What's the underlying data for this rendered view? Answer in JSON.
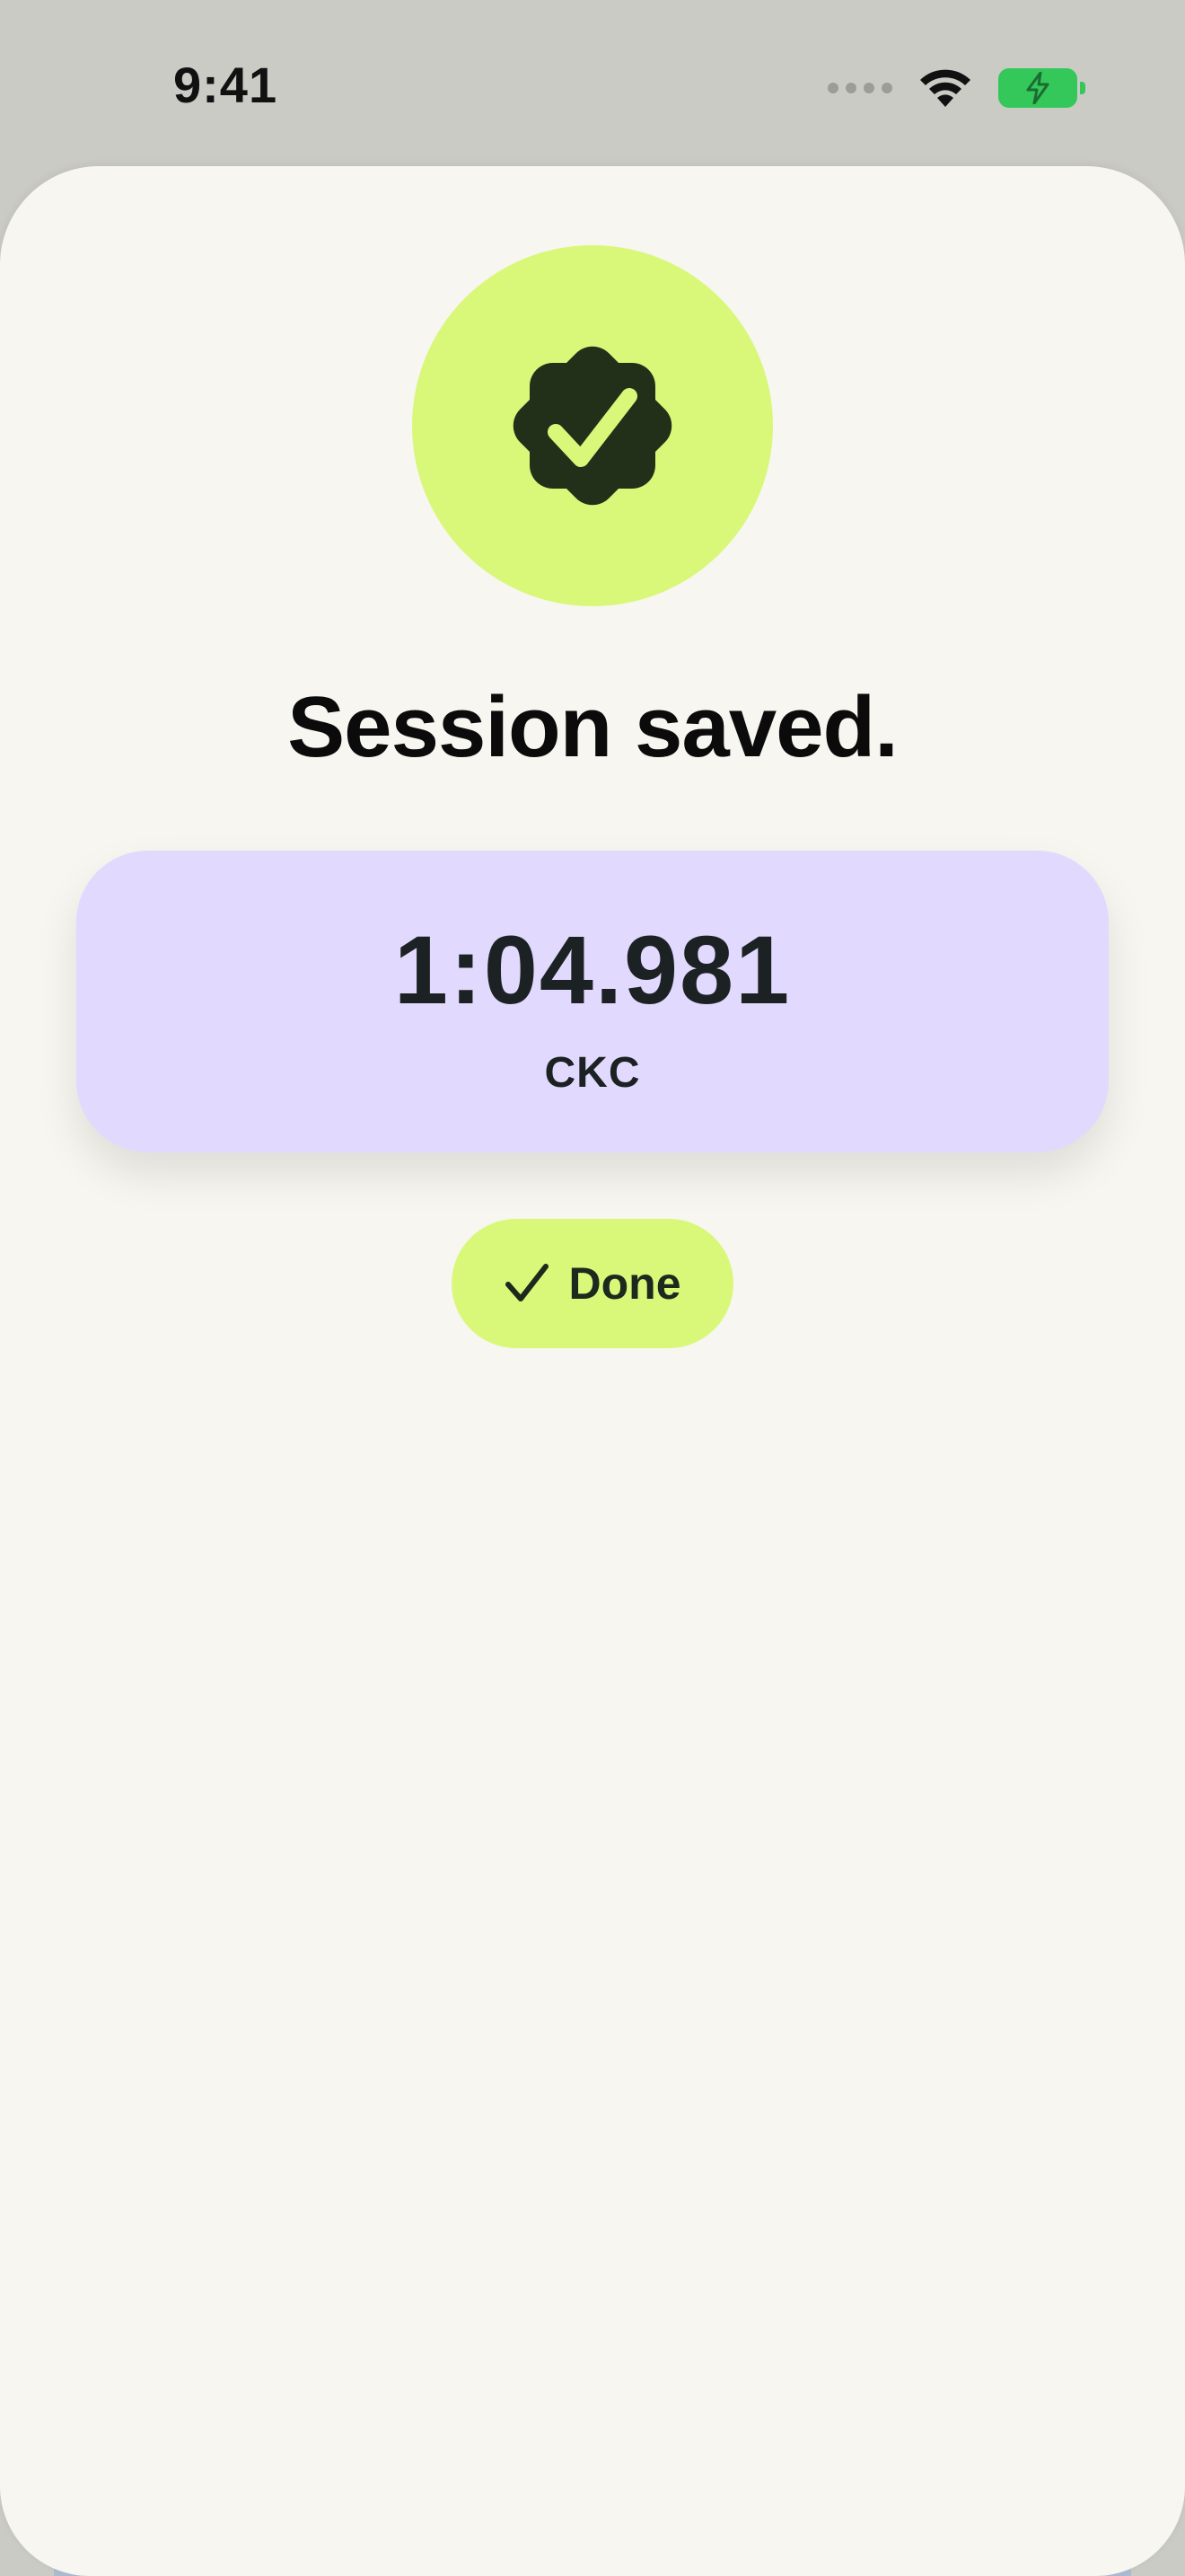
{
  "status_bar": {
    "time": "9:41",
    "icons": [
      "cellular-dots-icon",
      "wifi-icon",
      "battery-charging-icon"
    ],
    "battery_color": "#34c759"
  },
  "sheet": {
    "badge_icon": "checkmark-seal-icon",
    "badge_bg": "#d9f87a",
    "headline": "Session saved.",
    "result": {
      "time": "1:04.981",
      "label": "CKC",
      "bg": "#e2d9fe"
    },
    "done_button": {
      "icon": "checkmark-icon",
      "label": "Done"
    }
  }
}
